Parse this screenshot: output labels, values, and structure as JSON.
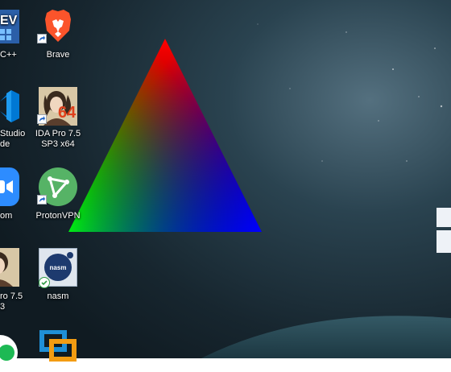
{
  "desktop": {
    "icons": [
      {
        "id": "cpp",
        "label": "C++",
        "icon": "visual-cpp-icon"
      },
      {
        "id": "brave",
        "label": "Brave",
        "icon": "brave-lion-icon"
      },
      {
        "id": "vscode",
        "label": "Studio\nde",
        "icon": "vscode-icon"
      },
      {
        "id": "ida64",
        "label": "IDA Pro 7.5\nSP3 x64",
        "icon": "ida-pro-icon",
        "badge": "64"
      },
      {
        "id": "zoom",
        "label": "om",
        "icon": "zoom-icon"
      },
      {
        "id": "protonvpn",
        "label": "ProtonVPN",
        "icon": "protonvpn-icon"
      },
      {
        "id": "ida32",
        "label": "ro 7.5\n3",
        "icon": "ida-pro-icon"
      },
      {
        "id": "nasm",
        "label": "nasm",
        "icon": "nasm-icon",
        "badge": "nasm"
      },
      {
        "id": "spotify",
        "label": "",
        "icon": "partial-app-icon"
      },
      {
        "id": "vmware",
        "label": "",
        "icon": "vmware-icon"
      }
    ],
    "colors": {
      "triangle_top": "#ff0000",
      "triangle_left": "#00ff00",
      "triangle_right": "#0000ff",
      "brave_orange": "#fb542b",
      "vscode_blue": "#0078d4",
      "zoom_blue": "#2d8cff",
      "protonvpn_green": "#56b366",
      "nasm_navy": "#1d3a6e"
    }
  }
}
